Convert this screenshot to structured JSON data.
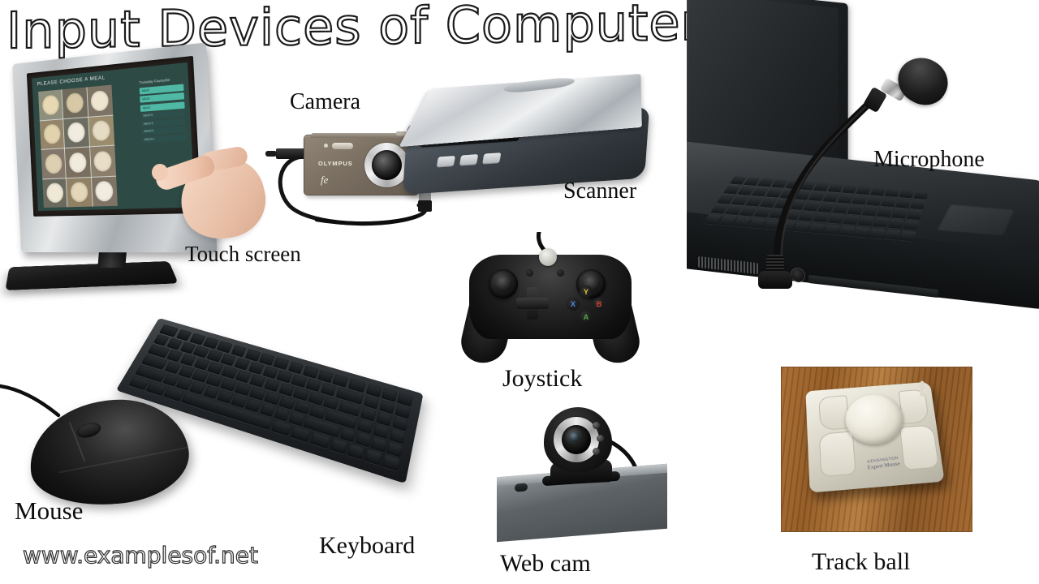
{
  "poster": {
    "title": "Input Devices of Computer",
    "watermark": "www.examplesof.net",
    "background_color": "#ffffff",
    "text_color": "#0d0d0d"
  },
  "labels": {
    "touch_screen": "Touch screen",
    "camera": "Camera",
    "scanner": "Scanner",
    "microphone": "Microphone",
    "mouse": "Mouse",
    "keyboard": "Keyboard",
    "joystick": "Joystick",
    "web_cam": "Web cam",
    "track_ball": "Track ball"
  },
  "devices": [
    {
      "name": "Touch screen",
      "label": "Touch screen",
      "description": "Silver-bezel POS touchscreen monitor on black stand with a hand touching the display",
      "screen": {
        "heading": "PLEASE CHOOSE A MEAL",
        "menu_title": "Tuesday Favourite",
        "background_color": "#2e4a45",
        "button_color": "#4fb9a5",
        "buttons": [
          "MEAT",
          "MEAT",
          "MEAT",
          "MEATS",
          "MEATS",
          "MEATS",
          "MEATS"
        ],
        "food_tiles": 12
      }
    },
    {
      "name": "Camera",
      "label": "Camera",
      "description": "Bronze compact digital camera with USB cable",
      "brand": "OLYMPUS",
      "model": "fe",
      "body_color": "#7d7264"
    },
    {
      "name": "Scanner",
      "label": "Scanner",
      "description": "Flatbed scanner with silver lid open and dark grey base",
      "lid_color": "#c9ccd0",
      "base_color": "#434a51",
      "button_count": 3
    },
    {
      "name": "Microphone",
      "label": "Microphone",
      "description": "Gooseneck microphone with black foam windscreen plugged into a black laptop",
      "windscreen_color": "#1d1d1d",
      "band_color": "#d8d8d8"
    },
    {
      "name": "Mouse",
      "label": "Mouse",
      "description": "Black wired optical mouse with scroll wheel",
      "body_color": "#131313"
    },
    {
      "name": "Keyboard",
      "label": "Keyboard",
      "description": "Black full-size USB keyboard at an angle with coiled cable",
      "body_color": "#23262a"
    },
    {
      "name": "Joystick",
      "label": "Joystick",
      "description": "Black wired game controller with analog sticks and D-pad",
      "body_color": "#121212",
      "face_buttons": [
        {
          "letter": "Y",
          "color": "#e4c62d"
        },
        {
          "letter": "X",
          "color": "#3b8fe0"
        },
        {
          "letter": "B",
          "color": "#d8402e"
        },
        {
          "letter": "A",
          "color": "#4aae3e"
        }
      ],
      "guide_button_color": "#c9c9c2"
    },
    {
      "name": "Web cam",
      "label": "Web cam",
      "description": "Clip-on webcam with silver lens ring and LEDs mounted on a grey monitor edge",
      "ring_color": "#ededed",
      "led_count": 3
    },
    {
      "name": "Track ball",
      "label": "Track ball",
      "description": "Beige trackball with large cream ball and four buttons on a wooden desk",
      "brand": "KENSINGTON",
      "model": "Expert Mouse",
      "ball_color": "#efece0",
      "desk_color": "#90571f"
    }
  ]
}
